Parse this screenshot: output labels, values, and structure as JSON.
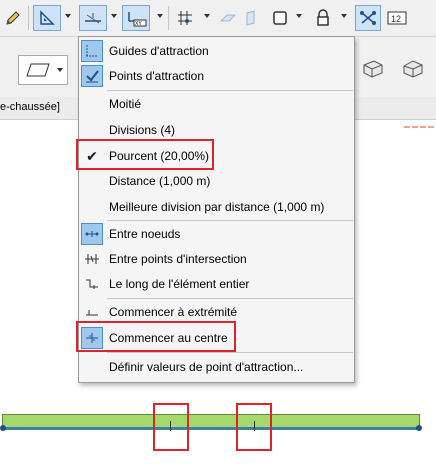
{
  "tab": {
    "label": "e-chaussée]"
  },
  "menu": {
    "items": [
      {
        "label": "Guides d'attraction",
        "icon": "guides-icon",
        "selected": true
      },
      {
        "label": "Points d'attraction",
        "icon": "points-icon",
        "selected": true
      },
      {
        "label": "Moitié"
      },
      {
        "label": "Divisions (4)"
      },
      {
        "label": "Pourcent (20,00%)",
        "checked": true
      },
      {
        "label": "Distance (1,000 m)"
      },
      {
        "label": "Meilleure division par distance (1,000 m)"
      },
      {
        "label": "Entre noeuds",
        "icon": "between-nodes-icon",
        "selected": true
      },
      {
        "label": "Entre points d'intersection",
        "icon": "intersection-points-icon"
      },
      {
        "label": "Le long de l'élément entier",
        "icon": "along-element-icon"
      },
      {
        "label": "Commencer à extrémité",
        "icon": "start-end-icon"
      },
      {
        "label": "Commencer au centre",
        "icon": "start-center-icon",
        "selected": true
      },
      {
        "label": "Définir valeurs de point d'attraction..."
      }
    ]
  },
  "toolbar": {
    "icons": [
      "pencil-icon",
      "ruler-triangle-icon",
      "snap-guide-icon",
      "xy-coordinate-icon",
      "grid-snap-icon",
      "plane-icon",
      "slab-icon",
      "frame-icon",
      "lock-icon",
      "snap-network-icon",
      "numeric-12-icon"
    ]
  },
  "colors": {
    "highlight_red": "#d9252b",
    "selection_blue": "#9fc8ec",
    "beam_green": "#a6d96a",
    "beam_line_blue": "#2b7fd6"
  }
}
